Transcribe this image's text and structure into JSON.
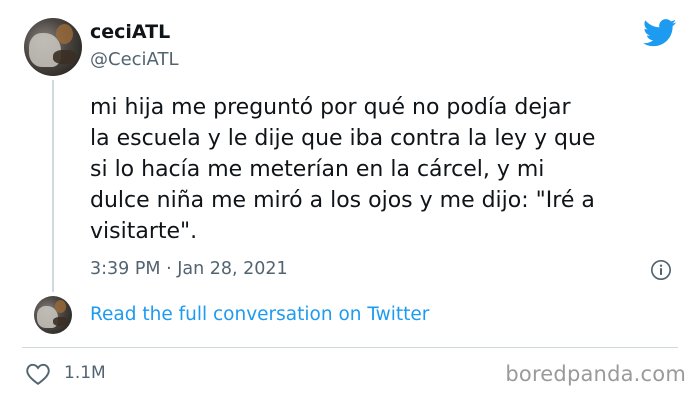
{
  "tweet": {
    "display_name": "ceciATL",
    "handle": "@CeciATL",
    "text": "mi hija me preguntó por qué no podía dejar\nla escuela y le dije que iba contra la ley y que\nsi lo hacía me meterían en la cárcel, y mi\ndulce niña me miró a los ojos y me dijo: \"Iré a\nvisitarte\".",
    "timestamp": "3:39 PM · Jan 28, 2021",
    "full_conversation_link": "Read the full conversation on Twitter",
    "like_count": "1.1M"
  },
  "icons": {
    "brand": "twitter-bird-icon",
    "info": "info-icon",
    "like": "heart-icon"
  },
  "watermark": "boredpanda.com",
  "colors": {
    "twitter_blue": "#1d9bf0",
    "text_primary": "#0f1419",
    "text_secondary": "#536471",
    "divider": "#cfd9de",
    "watermark": "#9a9a9a"
  }
}
